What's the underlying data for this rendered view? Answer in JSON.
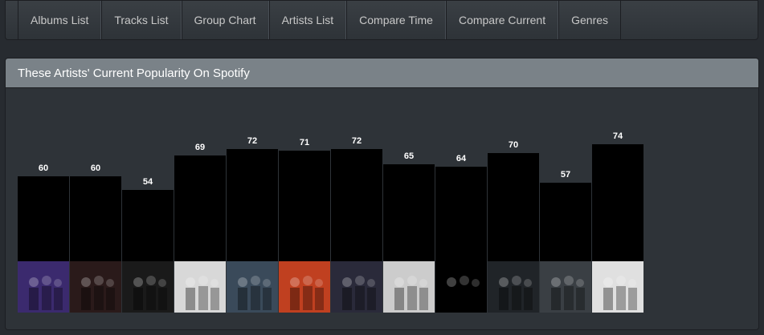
{
  "nav": {
    "items": [
      {
        "label": "Albums List"
      },
      {
        "label": "Tracks List"
      },
      {
        "label": "Group Chart"
      },
      {
        "label": "Artists List"
      },
      {
        "label": "Compare Time"
      },
      {
        "label": "Compare Current"
      },
      {
        "label": "Genres"
      }
    ]
  },
  "panel": {
    "title": "These Artists' Current Popularity On Spotify"
  },
  "chart_data": {
    "type": "bar",
    "values": [
      60,
      60,
      54,
      69,
      72,
      71,
      72,
      65,
      64,
      70,
      57,
      74
    ],
    "bar_color": "#000000",
    "label_color": "#ffffff",
    "image_colors": [
      "#3b2a6e",
      "#2a1a1a",
      "#1a1a1a",
      "#d8d8d8",
      "#3a4a5a",
      "#c04020",
      "#2a2a3a",
      "#cccccc",
      "#000000",
      "#202428",
      "#3a3f44",
      "#e0e0e0"
    ]
  },
  "colors": {
    "background": "#272b30",
    "panel_heading": "#7a8288",
    "panel_body": "#2e3338",
    "nav_text": "#c8c8c8"
  }
}
